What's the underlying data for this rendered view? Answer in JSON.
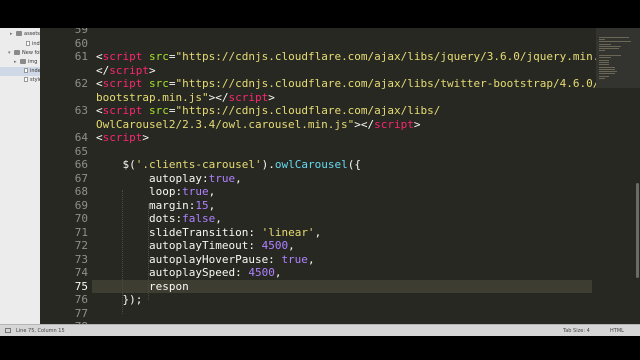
{
  "sidebar": {
    "items": [
      {
        "label": "assets",
        "kind": "folder",
        "twisty": "▸"
      },
      {
        "label": "index.html",
        "kind": "file",
        "twisty": ""
      },
      {
        "label": "New folder",
        "kind": "folder",
        "twisty": "▾"
      },
      {
        "label": "img",
        "kind": "folder",
        "twisty": "▸"
      },
      {
        "label": "index.html",
        "kind": "file",
        "twisty": "",
        "selected": true
      },
      {
        "label": "style.css",
        "kind": "file",
        "twisty": ""
      }
    ]
  },
  "editor": {
    "current_line": "75",
    "lines": [
      {
        "n": "59",
        "code": [
          {
            "t": "",
            "c": "pn"
          }
        ]
      },
      {
        "n": "60",
        "code": [
          {
            "t": "",
            "c": "pn"
          }
        ]
      },
      {
        "n": "61",
        "code": [
          {
            "t": "<",
            "c": "pn"
          },
          {
            "t": "script",
            "c": "tg"
          },
          {
            "t": " ",
            "c": "pn"
          },
          {
            "t": "src",
            "c": "at"
          },
          {
            "t": "=",
            "c": "pn"
          },
          {
            "t": "\"https://cdnjs.cloudflare.com/ajax/libs/jquery/3.6.0/jquery.min.js\"",
            "c": "st"
          },
          {
            "t": ">",
            "c": "pn"
          }
        ]
      },
      {
        "n": "",
        "code": [
          {
            "t": "</",
            "c": "pn"
          },
          {
            "t": "script",
            "c": "tg"
          },
          {
            "t": ">",
            "c": "pn"
          }
        ]
      },
      {
        "n": "62",
        "code": [
          {
            "t": "<",
            "c": "pn"
          },
          {
            "t": "script",
            "c": "tg"
          },
          {
            "t": " ",
            "c": "pn"
          },
          {
            "t": "src",
            "c": "at"
          },
          {
            "t": "=",
            "c": "pn"
          },
          {
            "t": "\"https://cdnjs.cloudflare.com/ajax/libs/twitter-bootstrap/4.6.0/js/",
            "c": "st"
          }
        ]
      },
      {
        "n": "",
        "code": [
          {
            "t": "bootstrap.min.js\"",
            "c": "st"
          },
          {
            "t": "></",
            "c": "pn"
          },
          {
            "t": "script",
            "c": "tg"
          },
          {
            "t": ">",
            "c": "pn"
          }
        ]
      },
      {
        "n": "63",
        "code": [
          {
            "t": "<",
            "c": "pn"
          },
          {
            "t": "script",
            "c": "tg"
          },
          {
            "t": " ",
            "c": "pn"
          },
          {
            "t": "src",
            "c": "at"
          },
          {
            "t": "=",
            "c": "pn"
          },
          {
            "t": "\"https://cdnjs.cloudflare.com/ajax/libs/",
            "c": "st"
          }
        ]
      },
      {
        "n": "",
        "code": [
          {
            "t": "OwlCarousel2/2.3.4/owl.carousel.min.js\"",
            "c": "st"
          },
          {
            "t": "></",
            "c": "pn"
          },
          {
            "t": "script",
            "c": "tg"
          },
          {
            "t": ">",
            "c": "pn"
          }
        ]
      },
      {
        "n": "64",
        "code": [
          {
            "t": "<",
            "c": "pn"
          },
          {
            "t": "script",
            "c": "tg"
          },
          {
            "t": ">",
            "c": "pn"
          }
        ]
      },
      {
        "n": "65",
        "code": [
          {
            "t": "",
            "c": "pn"
          }
        ]
      },
      {
        "n": "66",
        "code": [
          {
            "t": "    $(",
            "c": "pn"
          },
          {
            "t": "'.clients-carousel'",
            "c": "st"
          },
          {
            "t": ").",
            "c": "pn"
          },
          {
            "t": "owlCarousel",
            "c": "fn"
          },
          {
            "t": "({",
            "c": "pn"
          }
        ]
      },
      {
        "n": "67",
        "code": [
          {
            "t": "        autoplay:",
            "c": "pn"
          },
          {
            "t": "true",
            "c": "kw"
          },
          {
            "t": ",",
            "c": "pn"
          }
        ]
      },
      {
        "n": "68",
        "code": [
          {
            "t": "        loop:",
            "c": "pn"
          },
          {
            "t": "true",
            "c": "kw"
          },
          {
            "t": ",",
            "c": "pn"
          }
        ]
      },
      {
        "n": "69",
        "code": [
          {
            "t": "        margin:",
            "c": "pn"
          },
          {
            "t": "15",
            "c": "kw"
          },
          {
            "t": ",",
            "c": "pn"
          }
        ]
      },
      {
        "n": "70",
        "code": [
          {
            "t": "        dots:",
            "c": "pn"
          },
          {
            "t": "false",
            "c": "kw"
          },
          {
            "t": ",",
            "c": "pn"
          }
        ]
      },
      {
        "n": "71",
        "code": [
          {
            "t": "        slideTransition: ",
            "c": "pn"
          },
          {
            "t": "'linear'",
            "c": "st"
          },
          {
            "t": ",",
            "c": "pn"
          }
        ]
      },
      {
        "n": "72",
        "code": [
          {
            "t": "        autoplayTimeout: ",
            "c": "pn"
          },
          {
            "t": "4500",
            "c": "kw"
          },
          {
            "t": ",",
            "c": "pn"
          }
        ]
      },
      {
        "n": "73",
        "code": [
          {
            "t": "        autoplayHoverPause: ",
            "c": "pn"
          },
          {
            "t": "true",
            "c": "kw"
          },
          {
            "t": ",",
            "c": "pn"
          }
        ]
      },
      {
        "n": "74",
        "code": [
          {
            "t": "        autoplaySpeed: ",
            "c": "pn"
          },
          {
            "t": "4500",
            "c": "kw"
          },
          {
            "t": ",",
            "c": "pn"
          }
        ]
      },
      {
        "n": "75",
        "code": [
          {
            "t": "        respon",
            "c": "pn"
          }
        ]
      },
      {
        "n": "76",
        "code": [
          {
            "t": "    });",
            "c": "pn"
          }
        ]
      },
      {
        "n": "77",
        "code": [
          {
            "t": "",
            "c": "pn"
          }
        ]
      },
      {
        "n": "78",
        "code": [
          {
            "t": "",
            "c": "pn"
          }
        ]
      }
    ]
  },
  "statusbar": {
    "position": "Line 75, Column 15",
    "tab_size": "Tab Size: 4",
    "syntax": "HTML"
  },
  "colors": {
    "background": "#272822",
    "tag": "#f92672",
    "attribute": "#a6e22e",
    "string": "#e6db74",
    "function": "#66d9ef",
    "literal": "#ae81ff",
    "line_number": "#8f908a"
  }
}
